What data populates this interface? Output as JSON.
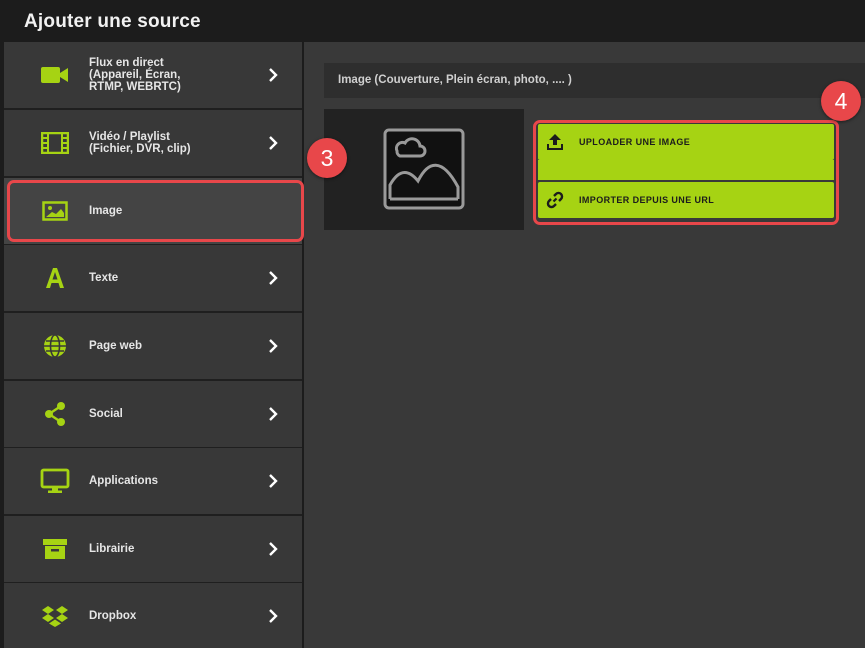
{
  "header": {
    "title": "Ajouter une source"
  },
  "sidebar": {
    "items": [
      {
        "label": "Flux en direct\n(Appareil, Écran,\nRTMP, WEBRTC)",
        "icon": "video-camera-icon"
      },
      {
        "label": "Vidéo / Playlist\n(Fichier, DVR, clip)",
        "icon": "film-strip-icon"
      },
      {
        "label": "Image",
        "icon": "image-icon"
      },
      {
        "label": "Texte",
        "icon": "text-a-icon"
      },
      {
        "label": "Page web",
        "icon": "globe-icon"
      },
      {
        "label": "Social",
        "icon": "share-icon"
      },
      {
        "label": "Applications",
        "icon": "monitor-icon"
      },
      {
        "label": "Librairie",
        "icon": "archive-box-icon"
      },
      {
        "label": "Dropbox",
        "icon": "dropbox-icon"
      }
    ]
  },
  "content": {
    "header": "Image (Couverture, Plein écran, photo, .... )",
    "buttons": {
      "upload": "UPLOADER UNE IMAGE",
      "import_url": "IMPORTER DEPUIS UNE URL"
    }
  },
  "markers": {
    "step3": "3",
    "step4": "4"
  },
  "colors": {
    "accent": "#a6d313",
    "highlight": "#e8474a",
    "panel": "#383838"
  }
}
